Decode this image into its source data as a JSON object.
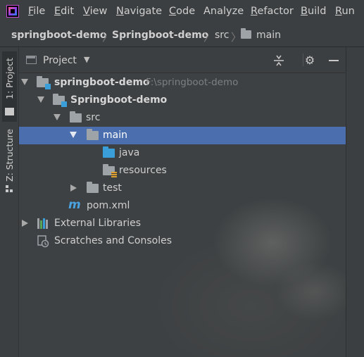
{
  "menu": {
    "items": [
      {
        "label": "File",
        "mnemonic": "F",
        "rest": "ile"
      },
      {
        "label": "Edit",
        "mnemonic": "E",
        "rest": "dit"
      },
      {
        "label": "View",
        "mnemonic": "V",
        "rest": "iew"
      },
      {
        "label": "Navigate",
        "mnemonic": "N",
        "rest": "avigate"
      },
      {
        "label": "Code",
        "mnemonic": "C",
        "rest": "ode"
      },
      {
        "label": "Analyze",
        "mnemonic": "",
        "rest": "Analyze"
      },
      {
        "label": "Refactor",
        "mnemonic": "R",
        "rest": "efactor"
      },
      {
        "label": "Build",
        "mnemonic": "B",
        "rest": "uild"
      },
      {
        "label": "Run",
        "mnemonic": "R",
        "rest": "un"
      }
    ]
  },
  "breadcrumb": {
    "items": [
      "springboot-demo",
      "Springboot-demo",
      "src",
      "main"
    ]
  },
  "left_strip": {
    "project_tab": "1: Project",
    "structure_tab": "Z: Structure"
  },
  "panel": {
    "title": "Project"
  },
  "tree": {
    "root_name": "springboot-demo",
    "root_path": "F:\\springboot-demo",
    "module_name": "Springboot-demo",
    "src": "src",
    "main": "main",
    "java": "java",
    "resources": "resources",
    "test": "test",
    "pom": "pom.xml",
    "external_libraries": "External Libraries",
    "scratches": "Scratches and Consoles"
  },
  "colors": {
    "background": "#3c3f41",
    "selection": "#4b6eaf",
    "source_folder": "#3a9fd8",
    "maven": "#4aa3e0"
  }
}
